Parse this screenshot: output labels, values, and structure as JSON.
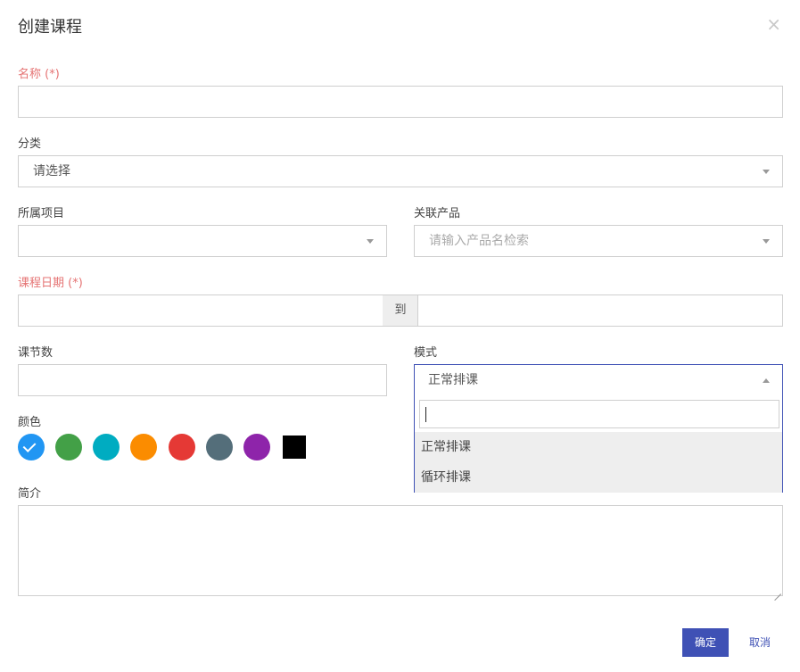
{
  "dialog": {
    "title": "创建课程",
    "close_glyph": "×"
  },
  "form": {
    "name": {
      "label": "名称 (*)",
      "value": ""
    },
    "category": {
      "label": "分类",
      "value": "请选择"
    },
    "project": {
      "label": "所属项目",
      "value": ""
    },
    "product": {
      "label": "关联产品",
      "placeholder": "请输入产品名检索"
    },
    "date": {
      "label": "课程日期 (*)",
      "separator": "到",
      "start": "",
      "end": ""
    },
    "lessons": {
      "label": "课节数",
      "value": ""
    },
    "mode": {
      "label": "模式",
      "value": "正常排课",
      "search_value": "",
      "options": [
        "正常排课",
        "循环排课"
      ]
    },
    "color": {
      "label": "颜色",
      "options": [
        "#2196f3",
        "#43a047",
        "#00acc1",
        "#fb8c00",
        "#e53935",
        "#546e7a",
        "#8e24aa",
        "#000000"
      ],
      "selected_index": 0
    },
    "intro": {
      "label": "简介",
      "value": ""
    }
  },
  "actions": {
    "confirm_label": "确定",
    "cancel_label": "取消"
  }
}
